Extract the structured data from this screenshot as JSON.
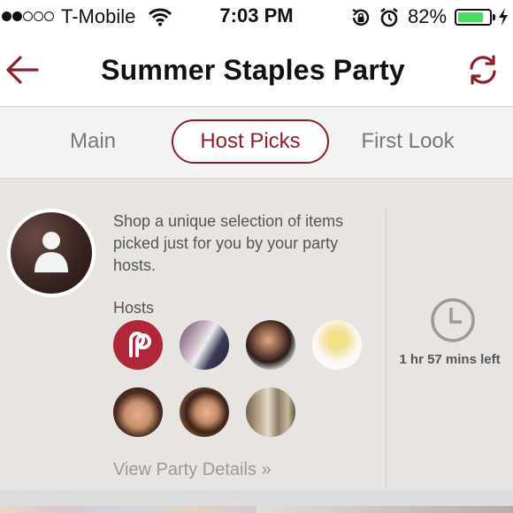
{
  "status_bar": {
    "carrier": "T-Mobile",
    "time": "7:03 PM",
    "battery_percent": "82%",
    "battery_level": 0.82,
    "signal_bars_filled": 2,
    "signal_bars_total": 5,
    "icons": [
      "wifi-icon",
      "rotation-lock-icon",
      "alarm-icon",
      "battery-icon",
      "charging-bolt-icon"
    ],
    "battery_color": "#4cd964"
  },
  "nav": {
    "title": "Summer Staples Party",
    "back_icon": "back-arrow-icon",
    "refresh_icon": "refresh-icon",
    "accent_color": "#8b1e2d"
  },
  "tabs": [
    {
      "label": "Main",
      "selected": false
    },
    {
      "label": "Host Picks",
      "selected": true
    },
    {
      "label": "First Look",
      "selected": false
    }
  ],
  "content": {
    "description": "Shop a unique selection of items picked just for you by your party hosts.",
    "hosts_label": "Hosts",
    "hosts_count": 7,
    "view_details": "View Party Details »",
    "time_left": "1 hr 57 mins left",
    "clock_icon": "clock-icon"
  }
}
